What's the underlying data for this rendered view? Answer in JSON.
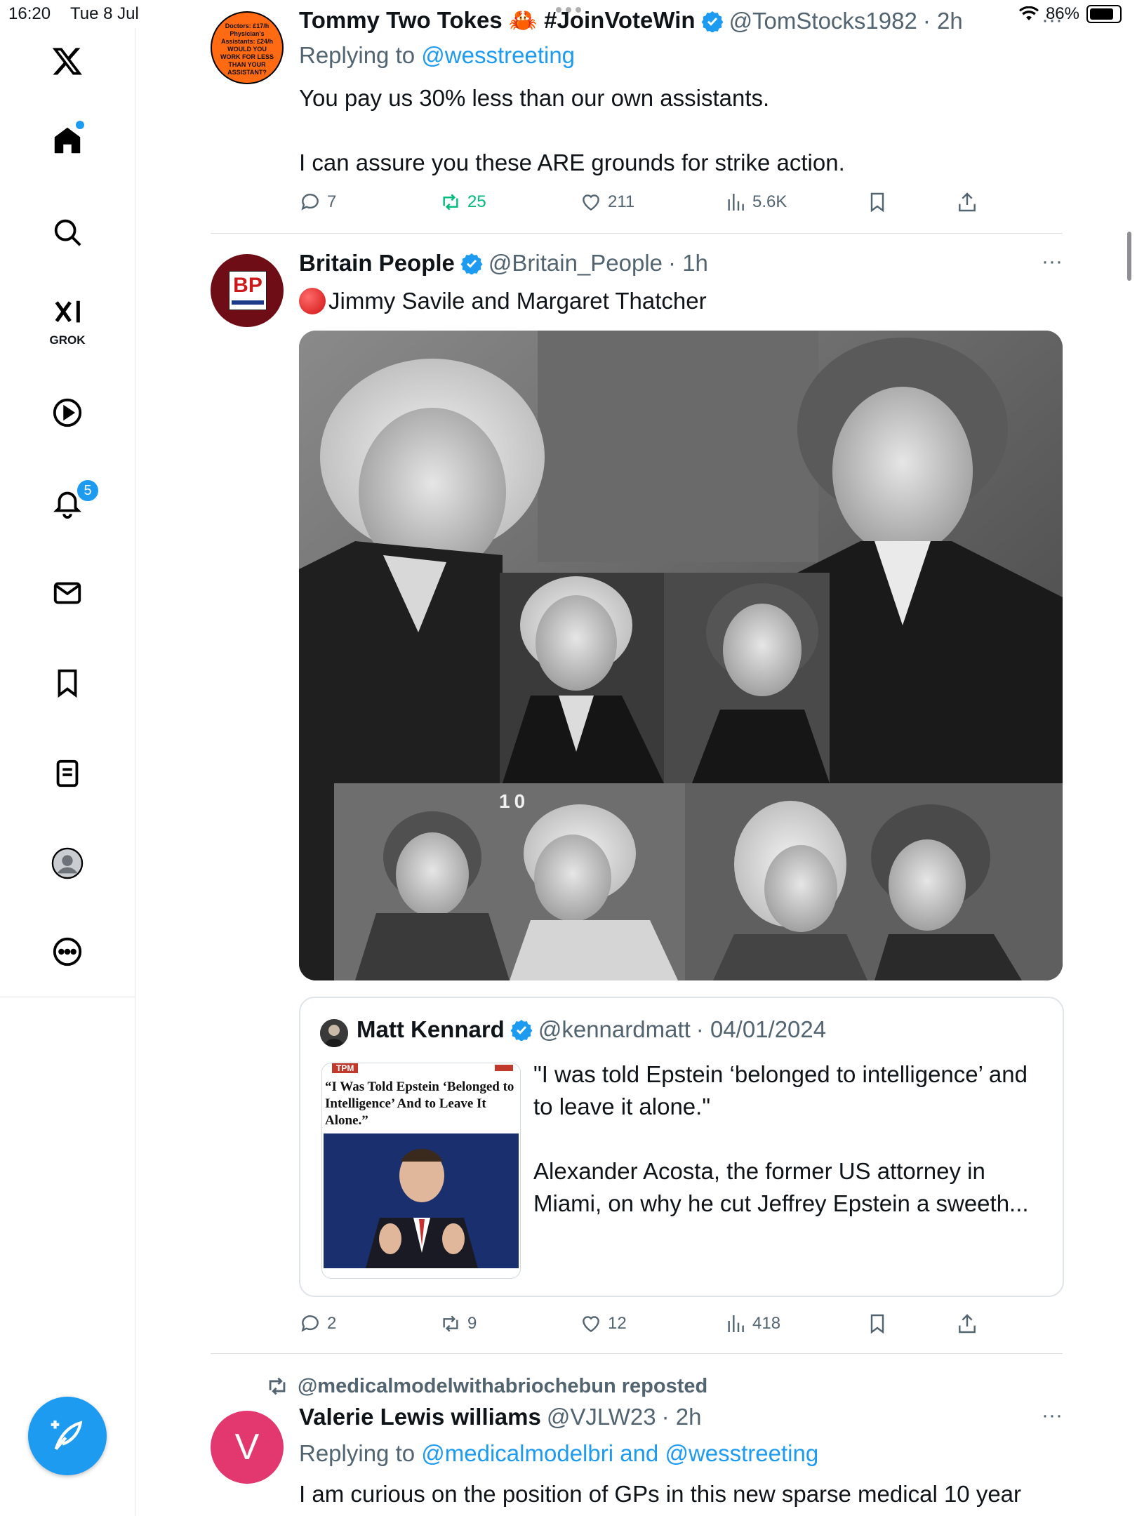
{
  "status_bar": {
    "time": "16:20",
    "date": "Tue 8 Jul",
    "battery": "86%",
    "battery_level": 0.86
  },
  "sidebar": {
    "items": [
      {
        "name": "x-logo"
      },
      {
        "name": "home"
      },
      {
        "name": "explore"
      },
      {
        "name": "grok",
        "label": "GROK"
      },
      {
        "name": "video"
      },
      {
        "name": "notifications",
        "badge": "5"
      },
      {
        "name": "messages"
      },
      {
        "name": "bookmarks"
      },
      {
        "name": "lists"
      },
      {
        "name": "profile"
      },
      {
        "name": "more"
      }
    ]
  },
  "tweets": [
    {
      "name": "Tommy Two Tokes 🦀 #JoinVoteWin",
      "handle": "@TomStocks1982",
      "time": "· 2h",
      "avatar_text": "Doctors: £17/h Physician's Assistants: £24/h WOULD YOU WORK FOR LESS THAN YOUR ASSISTANT?",
      "replying_prefix": "Replying to",
      "replying_to": "@wesstreeting",
      "text": "You pay us 30% less than our own assistants.\n\nI can assure you these ARE grounds for strike action.",
      "replies": "7",
      "reposts": "25",
      "likes": "211",
      "views": "5.6K"
    },
    {
      "name": "Britain People",
      "handle": "@Britain_People",
      "time": "· 1h",
      "avatar_text": "BP",
      "text": "Jimmy Savile and Margaret Thatcher",
      "photo_label": "10",
      "quote": {
        "name": "Matt Kennard",
        "handle": "@kennardmatt",
        "date": "· 04/01/2024",
        "thumb_brand": "TPM",
        "thumb_headline": "“I Was Told Epstein ‘Belonged to Intelligence’ And to Leave It Alone.”",
        "text": "\"I was told Epstein ‘belonged to intelligence’ and to leave it alone.\"\n\nAlexander Acosta, the former US attorney in Miami, on why he cut Jeffrey Epstein a sweeth..."
      },
      "replies": "2",
      "reposts": "9",
      "likes": "12",
      "views": "418"
    },
    {
      "repost_label": "@medicalmodelwithabriochebun reposted",
      "name": "Valerie Lewis williams",
      "handle": "@VJLW23",
      "time": "· 2h",
      "avatar_letter": "V",
      "replying_prefix": "Replying to",
      "replying_to": "@medicalmodelbri and @wesstreeting",
      "text": "I am curious on the position of GPs in this new sparse medical 10 year"
    }
  ],
  "colors": {
    "accent": "#1d9bf0",
    "repost_green": "#00ba7c",
    "muted": "#536471",
    "valerie_avatar": "#e2386f"
  }
}
